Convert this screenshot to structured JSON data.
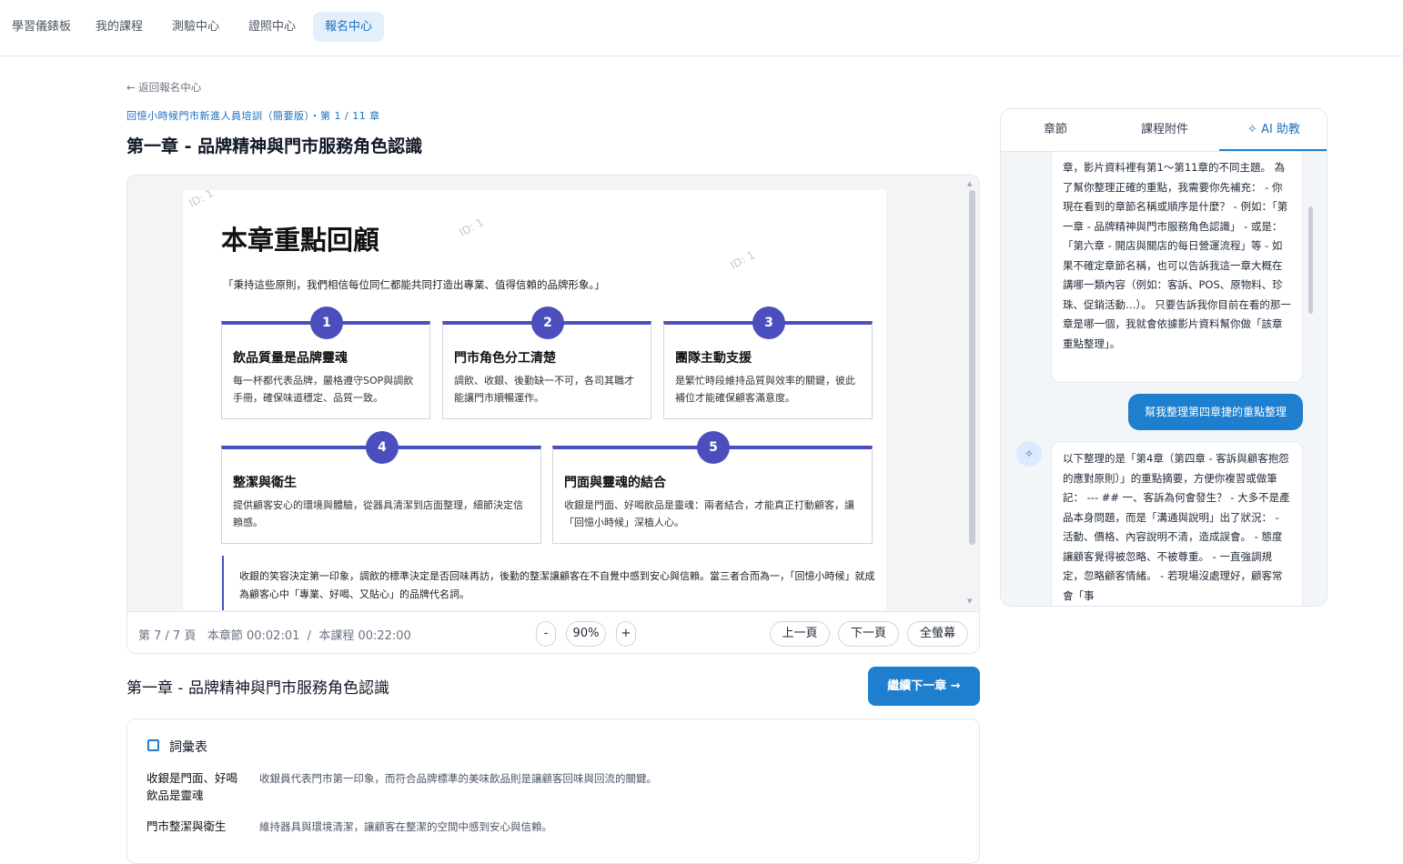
{
  "nav": {
    "items": [
      "學習儀錶板",
      "我的課程",
      "測驗中心",
      "證照中心",
      "報名中心"
    ],
    "active": "報名中心"
  },
  "back_link": "← 返回報名中心",
  "breadcrumb": "回憶小時候門市新進人員培訓（簡要版）・第 1 / 11 章",
  "page_title": "第一章 - 品牌精神與門市服務角色認識",
  "slide": {
    "watermark": "ID: 1",
    "heading": "本章重點回顧",
    "quote": "「秉持這些原則，我們相信每位同仁都能共同打造出專業、值得信賴的品牌形象。」",
    "cards": [
      {
        "num": "1",
        "title": "飲品質量是品牌靈魂",
        "desc": "每一杯都代表品牌，嚴格遵守SOP與調飲手冊，確保味道穩定、品質一致。"
      },
      {
        "num": "2",
        "title": "門市角色分工清楚",
        "desc": "調飲、收銀、後勤缺一不可，各司其職才能讓門市順暢運作。"
      },
      {
        "num": "3",
        "title": "團隊主動支援",
        "desc": "是繁忙時段維持品質與效率的關鍵，彼此補位才能確保顧客滿意度。"
      },
      {
        "num": "4",
        "title": "整潔與衛生",
        "desc": "提供顧客安心的環境與體驗，從器具清潔到店面整理，細節決定信賴感。"
      },
      {
        "num": "5",
        "title": "門面與靈魂的結合",
        "desc": "收銀是門面、好喝飲品是靈魂：兩者結合，才能真正打動顧客，讓「回憶小時候」深植人心。"
      }
    ],
    "summary": "收銀的笑容決定第一印象，調飲的標準決定是否回味再訪，後勤的整潔讓顧客在不自覺中感到安心與信賴。當三者合而為一，「回憶小時候」就成為顧客心中「專業、好喝、又貼心」的品牌代名詞。"
  },
  "viewer": {
    "page_info": "第 7 / 7 頁",
    "chapter_time": "本章節 00:02:01",
    "separator": "/",
    "course_time": "本課程 00:22:00",
    "zoom_out": "-",
    "zoom": "90%",
    "zoom_in": "+",
    "prev": "上一頁",
    "next": "下一頁",
    "fullscreen": "全螢幕"
  },
  "next_chapter": {
    "title": "第一章 - 品牌精神與門市服務角色認識",
    "button": "繼續下一章 →"
  },
  "glossary": {
    "heading": "詞彙表",
    "entries": [
      {
        "term": "收銀是門面、好喝飲品是靈魂",
        "def": "收銀員代表門市第一印象，而符合品牌標準的美味飲品則是讓顧客回味與回流的關鍵。"
      },
      {
        "term": "門市整潔與衛生",
        "def": "維持器具與環境清潔，讓顧客在整潔的空間中感到安心與信賴。"
      }
    ]
  },
  "side_panel": {
    "tabs": [
      "章節",
      "課程附件",
      "✧ AI 助教"
    ],
    "messages": {
      "ai_1": "章，影片資料裡有第1～第11章的不同主題。 為了幫你整理正確的重點，我需要你先補充： - 你現在看到的章節名稱或順序是什麼？ - 例如：「第一章 - 品牌精神與門市服務角色認識」 - 或是：「第六章 - 開店與關店的每日營運流程」等 - 如果不確定章節名稱，也可以告訴我這一章大概在講哪一類內容（例如：客訴、POS、原物料、珍珠、促銷活動…）。 只要告訴我你目前在看的那一章是哪一個，我就會依據影片資料幫你做「該章重點整理」。",
      "user_1": "幫我整理第四章捷的重點整理",
      "ai_2": "以下整理的是「第4章（第四章 - 客訴與顧客抱怨的應對原則）」的重點摘要，方便你複習或做筆記： --- ## 一、客訴為何會發生？ - 大多不是產品本身問題，而是「溝通與說明」出了狀況： - 活動、價格、內容說明不清，造成誤會。 - 態度讓顧客覺得被忽略、不被尊重。 - 一直強調規定，忽略顧客情緒。 - 若現場沒處理好，顧客常會「事"
    }
  }
}
